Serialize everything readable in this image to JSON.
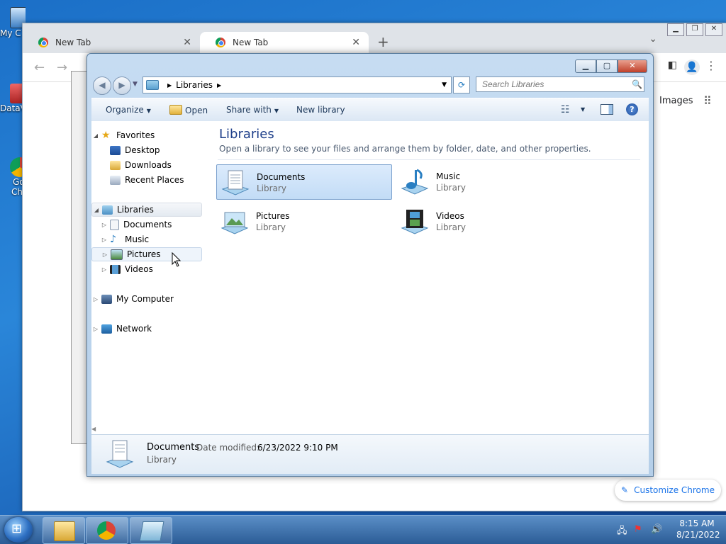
{
  "desktop": {
    "icons": [
      {
        "label": "My C"
      },
      {
        "label": "DataV"
      },
      {
        "label": "Go"
      },
      {
        "label": "Ch"
      }
    ]
  },
  "chrome": {
    "tabs": [
      {
        "title": "New Tab",
        "close": "✕"
      },
      {
        "title": "New Tab",
        "close": "✕"
      }
    ],
    "new_tab": "+",
    "tab_dropdown": "⌄",
    "window_buttons": [
      "▁",
      "❐",
      "✕"
    ],
    "back": "←",
    "forward": "→",
    "images_link": "Images",
    "apps_grid": "⠿",
    "customize_label": "Customize Chrome",
    "customize_icon": "✎",
    "side_panel_icon": "◧",
    "avatar_icon": "👤",
    "menu_icon": "⋮"
  },
  "explorer": {
    "caption_buttons": {
      "min": "▁",
      "max": "▢",
      "close": "✕"
    },
    "back": "◀",
    "forward": "▶",
    "recent_dropdown": "▼",
    "address": {
      "crumb": "Libraries",
      "arrow": "▶",
      "dropdown": "▼"
    },
    "refresh": "⟳",
    "search": {
      "placeholder": "Search Libraries",
      "icon": "🔍"
    },
    "commands": {
      "organize": "Organize",
      "open": "Open",
      "share_with": "Share with",
      "new_library": "New library",
      "arrow": "▼",
      "view_icon": "☷",
      "help": "?"
    },
    "nav": {
      "favorites": "Favorites",
      "desktop": "Desktop",
      "downloads": "Downloads",
      "recent_places": "Recent Places",
      "libraries": "Libraries",
      "documents": "Documents",
      "music": "Music",
      "pictures": "Pictures",
      "videos": "Videos",
      "my_computer": "My Computer",
      "network": "Network",
      "expanded": "◢",
      "collapsed": "▷",
      "scroll_left": "◀"
    },
    "content": {
      "title": "Libraries",
      "subtitle": "Open a library to see your files and arrange them by folder, date, and other properties.",
      "tiles": [
        {
          "name": "Documents",
          "type": "Library"
        },
        {
          "name": "Music",
          "type": "Library"
        },
        {
          "name": "Pictures",
          "type": "Library"
        },
        {
          "name": "Videos",
          "type": "Library"
        }
      ]
    },
    "details": {
      "name": "Documents",
      "modified_label": "Date modified:",
      "modified_value": "6/23/2022 9:10 PM",
      "type": "Library"
    }
  },
  "taskbar": {
    "time": "8:15 AM",
    "date": "8/21/2022",
    "tray": {
      "network": "🖧",
      "flag": "⚑",
      "volume": "🔊"
    }
  }
}
